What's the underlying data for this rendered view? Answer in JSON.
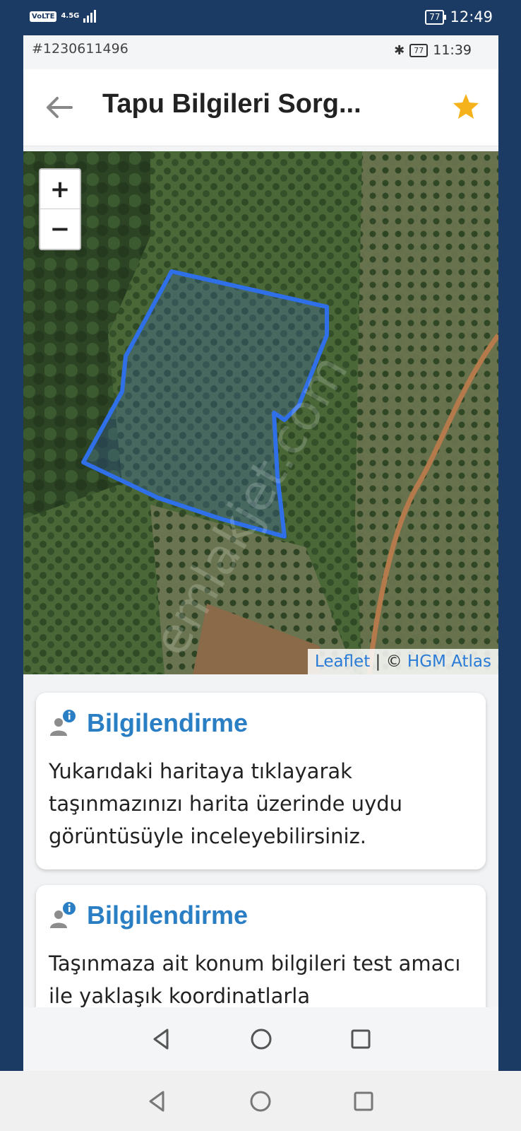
{
  "outer_status": {
    "net_type": "4.5G",
    "volte": "VoLTE",
    "battery": "77",
    "time": "12:49"
  },
  "inner_status": {
    "cell_id": "#1230611496",
    "battery": "77",
    "time": "11:39"
  },
  "app_bar": {
    "title": "Tapu Bilgileri Sorg...",
    "back_icon": "back-arrow-icon",
    "favorite_icon": "star-icon"
  },
  "map": {
    "zoom_in": "+",
    "zoom_out": "−",
    "attribution_leaflet": "Leaflet",
    "attribution_sep": " | © ",
    "attribution_source": "HGM Atlas",
    "parcel_outline_color": "#2f6fe8"
  },
  "watermark": "emlakjet.com",
  "cards": [
    {
      "title": "Bilgilendirme",
      "text": "Yukarıdaki haritaya tıklayarak taşınmazınızı harita üzerinde uydu görüntüsüyle inceleyebilirsiniz."
    },
    {
      "title": "Bilgilendirme",
      "text": "Taşınmaza ait konum bilgileri test amacı ile yaklaşık koordinatlarla"
    }
  ],
  "colors": {
    "accent": "#2a7ec4",
    "star": "#f6b21b",
    "status_bar": "#1b3a64"
  }
}
